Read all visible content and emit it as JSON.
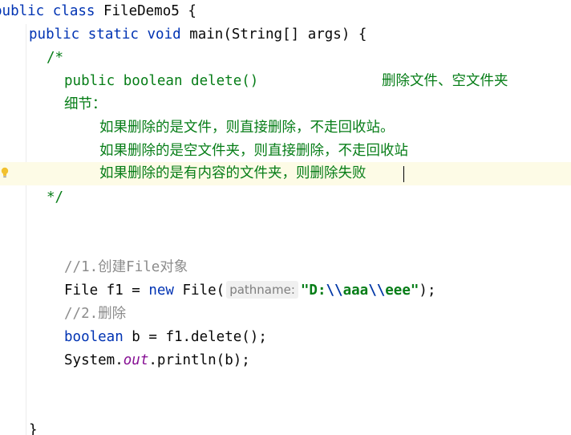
{
  "code": {
    "line1": {
      "kw": "public class ",
      "name": "FileDemo5 {"
    },
    "line2": {
      "kw": "public static void ",
      "rest": "main(String[] args) {"
    },
    "line3": {
      "text": "/*"
    },
    "line4": {
      "sig": "public boolean delete()",
      "desc": "删除文件、空文件夹"
    },
    "line5": {
      "text": "细节："
    },
    "line6": {
      "text": "如果删除的是文件，则直接删除，不走回收站。"
    },
    "line7": {
      "text": "如果删除的是空文件夹，则直接删除，不走回收站"
    },
    "line8": {
      "text": "如果删除的是有内容的文件夹，则删除失败"
    },
    "line9": {
      "text": "*/"
    },
    "line12": {
      "prefix": "//1.",
      "cn1": "创建",
      "mid": "File",
      "cn2": "对象"
    },
    "line13": {
      "a": "File f1 = ",
      "kw": "new",
      "b": " File(",
      "hint": "pathname:",
      "s1": "\"D:",
      "e1": "\\\\",
      "s2": "aaa",
      "e2": "\\\\",
      "s3": "eee\"",
      "end": ");"
    },
    "line14": {
      "prefix": "//2.",
      "cn": "删除"
    },
    "line15": {
      "kw": "boolean",
      "rest": " b = f1.delete();"
    },
    "line16": {
      "a": "System.",
      "field": "out",
      "b": ".println(b);"
    },
    "line19": {
      "text": "}"
    }
  },
  "colors": {
    "keyword": "#0033b3",
    "comment": "#8c8c8c",
    "doc_comment": "#067d17",
    "string": "#067d17",
    "escape": "#0037a6",
    "static_field": "#871094",
    "current_line": "#fdfbe6"
  },
  "icons": {
    "gutter": "lightbulb-icon"
  }
}
